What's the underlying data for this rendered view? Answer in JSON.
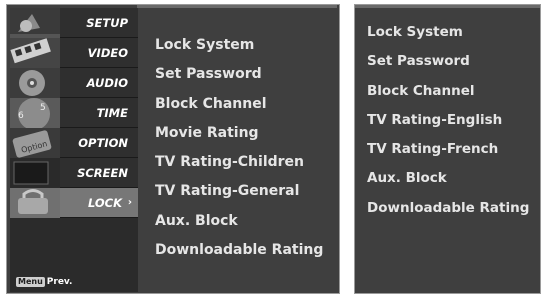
{
  "sidebar": {
    "items": [
      {
        "label": "SETUP",
        "icon": "satellite-dish-icon"
      },
      {
        "label": "VIDEO",
        "icon": "video-film-icon"
      },
      {
        "label": "AUDIO",
        "icon": "audio-disc-icon"
      },
      {
        "label": "TIME",
        "icon": "clock-icon"
      },
      {
        "label": "OPTION",
        "icon": "option-tag-icon"
      },
      {
        "label": "SCREEN",
        "icon": "screen-icon"
      },
      {
        "label": "LOCK",
        "icon": "lock-icon",
        "selected": true
      }
    ],
    "hint_key": "Menu",
    "hint_text": "Prev."
  },
  "left_submenu": {
    "items": [
      "Lock System",
      "Set Password",
      "Block Channel",
      "Movie Rating",
      "TV Rating-Children",
      "TV Rating-General",
      "Aux. Block",
      "Downloadable Rating"
    ]
  },
  "right_submenu": {
    "items": [
      "Lock System",
      "Set Password",
      "Block Channel",
      "TV Rating-English",
      "TV Rating-French",
      "Aux. Block",
      "Downloadable Rating"
    ]
  },
  "colors": {
    "panel_bg": "#3f3f3f",
    "sidebar_bg": "#2b2b2b",
    "selected_bg": "#777777",
    "text": "#e6e6e6"
  }
}
